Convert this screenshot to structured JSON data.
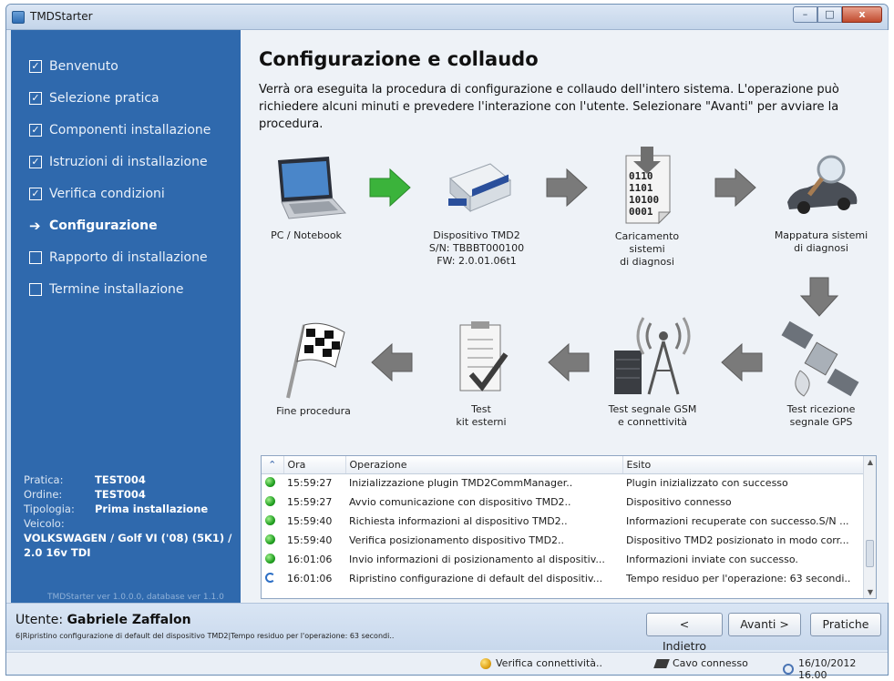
{
  "window": {
    "title": "TMDStarter",
    "buttons": {
      "minimize": "–",
      "maximize": "□",
      "close": "x"
    }
  },
  "sidebar": {
    "steps": [
      {
        "label": "Benvenuto",
        "state": "done"
      },
      {
        "label": "Selezione pratica",
        "state": "done"
      },
      {
        "label": "Componenti installazione",
        "state": "done"
      },
      {
        "label": "Istruzioni di installazione",
        "state": "done"
      },
      {
        "label": "Verifica condizioni",
        "state": "done"
      },
      {
        "label": "Configurazione",
        "state": "current"
      },
      {
        "label": "Rapporto di installazione",
        "state": "todo"
      },
      {
        "label": "Termine installazione",
        "state": "todo"
      }
    ],
    "check_glyph": "✓",
    "arrow_glyph": "➔",
    "info": {
      "pratica_label": "Pratica:",
      "pratica_value": "TEST004",
      "ordine_label": "Ordine:",
      "ordine_value": "TEST004",
      "tipologia_label": "Tipologia:",
      "tipologia_value": "Prima installazione",
      "veicolo_label": "Veicolo:",
      "veicolo_value": "VOLKSWAGEN / Golf VI ('08) (5K1) / 2.0 16v TDI"
    },
    "version": "TMDStarter ver 1.0.0.0, database ver 1.1.0"
  },
  "main": {
    "title": "Configurazione e collaudo",
    "intro": "Verrà ora eseguita la procedura di configurazione e collaudo dell'intero sistema. L'operazione può richiedere alcuni minuti e prevedere l'interazione con l'utente. Selezionare \"Avanti\" per avviare la procedura.",
    "flow": {
      "pc": "PC / Notebook",
      "device": "Dispositivo TMD2\nS/N: TBBBT000100\nFW: 2.0.01.06t1",
      "loading": "Caricamento\nsistemi\ndi diagnosi",
      "mapping": "Mappatura sistemi\ndi diagnosi",
      "gps": "Test ricezione\nsegnale GPS",
      "gsm": "Test segnale GSM\ne connettività",
      "kit": "Test\nkit esterni",
      "end": "Fine procedura",
      "binary_text": "0110\n1101\n101000\n0001"
    },
    "log": {
      "collapse_glyph": "⌃",
      "columns": {
        "ora": "Ora",
        "operazione": "Operazione",
        "esito": "Esito"
      },
      "rows": [
        {
          "status": "ok",
          "ora": "15:59:27",
          "operazione": "Inizializzazione plugin TMD2CommManager..",
          "esito": "Plugin inizializzato con successo"
        },
        {
          "status": "ok",
          "ora": "15:59:27",
          "operazione": "Avvio comunicazione con dispositivo TMD2..",
          "esito": "Dispositivo connesso"
        },
        {
          "status": "ok",
          "ora": "15:59:40",
          "operazione": "Richiesta informazioni al dispositivo TMD2..",
          "esito": "Informazioni recuperate con successo.S/N ..."
        },
        {
          "status": "ok",
          "ora": "15:59:40",
          "operazione": "Verifica posizionamento dispositivo TMD2..",
          "esito": "Dispositivo TMD2 posizionato in modo corr..."
        },
        {
          "status": "ok",
          "ora": "16:01:06",
          "operazione": "Invio informazioni di posizionamento al dispositiv...",
          "esito": "Informazioni inviate con successo."
        },
        {
          "status": "running",
          "ora": "16:01:06",
          "operazione": "Ripristino configurazione di default del dispositiv...",
          "esito": "Tempo residuo per l'operazione: 63 secondi.."
        }
      ]
    }
  },
  "footer": {
    "user_label": "Utente:",
    "user_name": "Gabriele Zaffalon",
    "status_text": "6|Ripristino configurazione di default del dispositivo TMD2|Tempo residuo per l'operazione: 63 secondi..",
    "back_button": "< Indietro",
    "next_button": "Avanti >",
    "pratiche_button": "Pratiche"
  },
  "statusbar": {
    "connectivity": "Verifica connettività..",
    "cable": "Cavo connesso",
    "datetime": "16/10/2012 16.00"
  },
  "colors": {
    "sidebar": "#2f69ad",
    "flow_arrow_active": "#3bb33b",
    "flow_arrow": "#7a7a7a",
    "ok_status": "#22a022",
    "running_status": "#2b6ec5"
  }
}
